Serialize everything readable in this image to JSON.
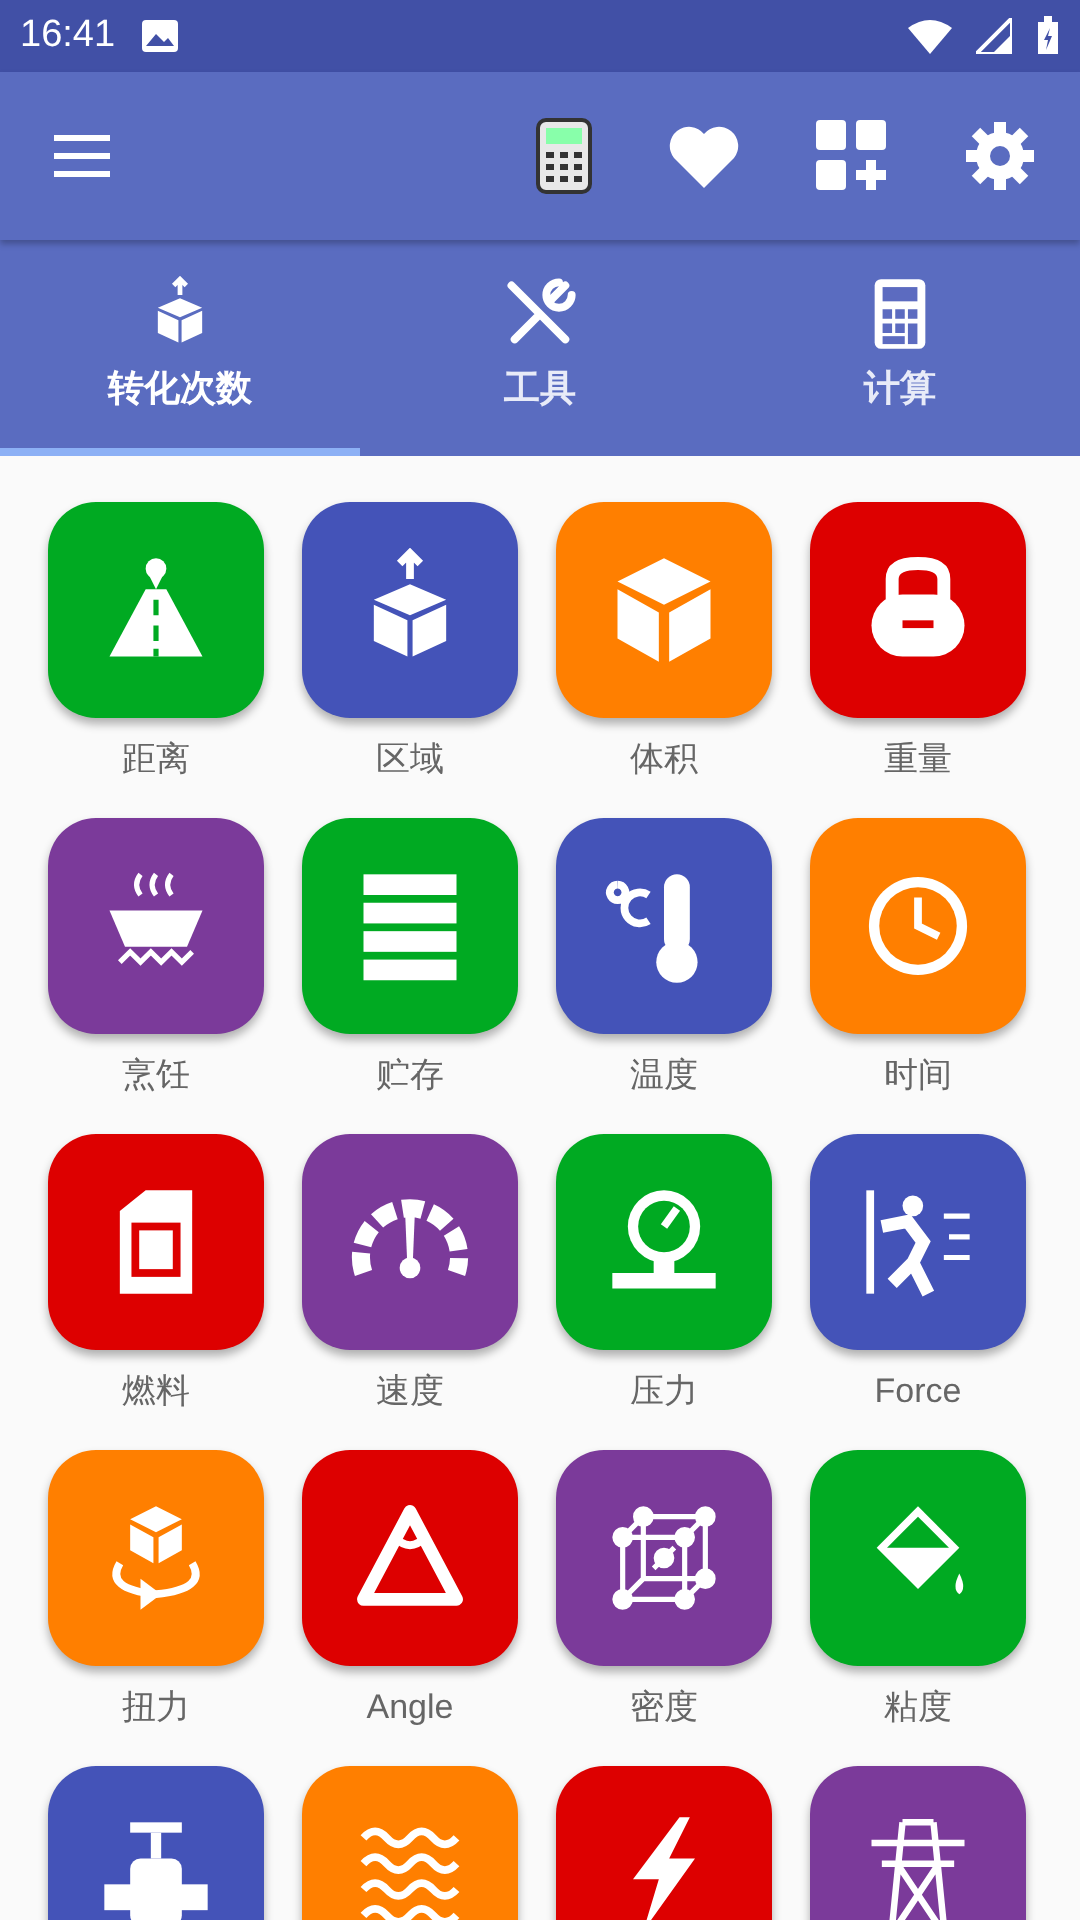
{
  "status_bar": {
    "time": "16:41"
  },
  "tabs": [
    {
      "label": "转化次数",
      "kind": "convert",
      "selected": true
    },
    {
      "label": "工具",
      "kind": "tools",
      "selected": false
    },
    {
      "label": "计算",
      "kind": "calc",
      "selected": false
    }
  ],
  "tiles": [
    {
      "label": "距离",
      "kind": "road",
      "color": "#00aa22"
    },
    {
      "label": "区域",
      "kind": "area",
      "color": "#4453b8"
    },
    {
      "label": "体积",
      "kind": "cube",
      "color": "#ff7f00"
    },
    {
      "label": "重量",
      "kind": "weight",
      "color": "#dd0000"
    },
    {
      "label": "烹饪",
      "kind": "cooking",
      "color": "#7b3a9a"
    },
    {
      "label": "贮存",
      "kind": "storage",
      "color": "#00aa22"
    },
    {
      "label": "温度",
      "kind": "thermo",
      "color": "#4453b8"
    },
    {
      "label": "时间",
      "kind": "clock",
      "color": "#ff7f00"
    },
    {
      "label": "燃料",
      "kind": "fuel",
      "color": "#dd0000"
    },
    {
      "label": "速度",
      "kind": "speed",
      "color": "#7b3a9a"
    },
    {
      "label": "压力",
      "kind": "pressure",
      "color": "#00aa22"
    },
    {
      "label": "Force",
      "kind": "force",
      "color": "#4453b8"
    },
    {
      "label": "扭力",
      "kind": "torque",
      "color": "#ff7f00"
    },
    {
      "label": "Angle",
      "kind": "angle",
      "color": "#dd0000"
    },
    {
      "label": "密度",
      "kind": "density",
      "color": "#7b3a9a"
    },
    {
      "label": "粘度",
      "kind": "viscosity",
      "color": "#00aa22"
    },
    {
      "kind": "valve",
      "color": "#4453b8"
    },
    {
      "kind": "waves",
      "color": "#ff7f00"
    },
    {
      "kind": "lightning",
      "color": "#dd0000"
    },
    {
      "kind": "tower",
      "color": "#7b3a9a"
    }
  ]
}
